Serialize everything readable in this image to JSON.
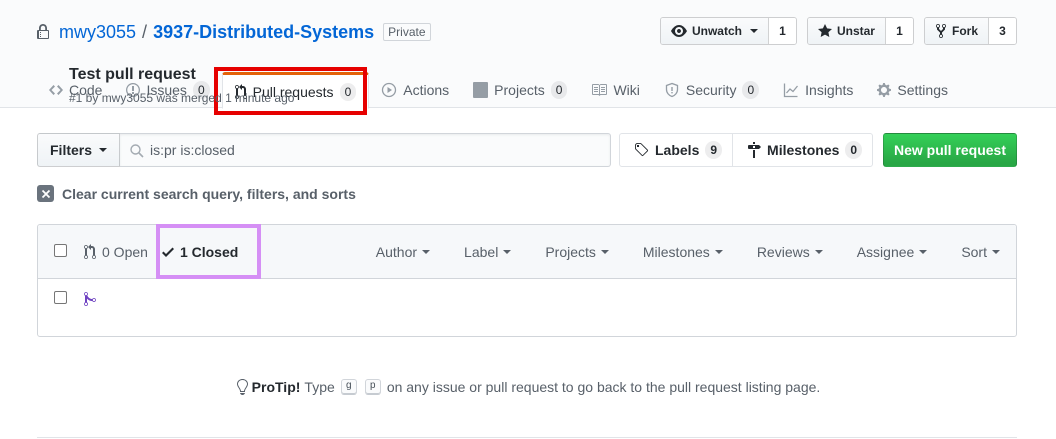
{
  "repo": {
    "owner": "mwy3055",
    "separator": "/",
    "name": "3937-Distributed-Systems",
    "visibility": "Private"
  },
  "actions": {
    "watch": {
      "label": "Unwatch",
      "count": "1"
    },
    "star": {
      "label": "Unstar",
      "count": "1"
    },
    "fork": {
      "label": "Fork",
      "count": "3"
    }
  },
  "tabs": [
    {
      "label": "Code",
      "icon": "code-icon"
    },
    {
      "label": "Issues",
      "count": "0",
      "icon": "issue-icon"
    },
    {
      "label": "Pull requests",
      "count": "0",
      "icon": "git-pull-request-icon",
      "selected": true
    },
    {
      "label": "Actions",
      "icon": "play-icon"
    },
    {
      "label": "Projects",
      "count": "0",
      "icon": "project-icon"
    },
    {
      "label": "Wiki",
      "icon": "book-icon"
    },
    {
      "label": "Security",
      "count": "0",
      "icon": "shield-icon"
    },
    {
      "label": "Insights",
      "icon": "graph-icon"
    },
    {
      "label": "Settings",
      "icon": "gear-icon"
    }
  ],
  "filters": {
    "button_label": "Filters",
    "query": "is:pr is:closed"
  },
  "labels": {
    "label": "Labels",
    "count": "9"
  },
  "milestones": {
    "label": "Milestones",
    "count": "0"
  },
  "new_pr_label": "New pull request",
  "clear_query_label": "Clear current search query, filters, and sorts",
  "states": {
    "open": "0 Open",
    "closed": "1 Closed"
  },
  "sort_menus": [
    "Author",
    "Label",
    "Projects",
    "Milestones",
    "Reviews",
    "Assignee",
    "Sort"
  ],
  "pull_requests": [
    {
      "title": "Test pull request",
      "meta": "#1 by mwy3055 was merged 1 minute ago",
      "state": "merged"
    }
  ],
  "protip": {
    "label": "ProTip!",
    "before": "Type",
    "key1": "g",
    "key2": "p",
    "after": "on any issue or pull request to go back to the pull request listing page."
  },
  "colors": {
    "link": "#0366d6",
    "primary_button": "#28a745",
    "merged": "#6f42c1",
    "highlight_red": "#e60000",
    "highlight_purple": "#d58ff5"
  }
}
